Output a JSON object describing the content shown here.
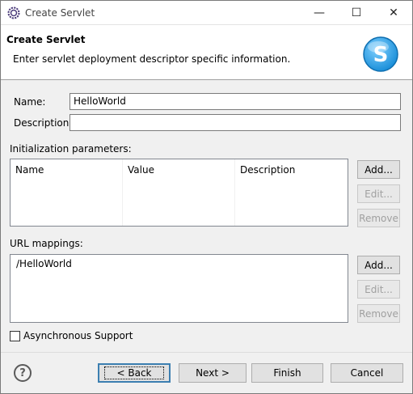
{
  "window": {
    "title": "Create Servlet",
    "minimize_glyph": "—",
    "maximize_glyph": "☐",
    "close_glyph": "✕"
  },
  "header": {
    "title": "Create Servlet",
    "message": "Enter servlet deployment descriptor specific information.",
    "logo_letter": "S"
  },
  "form": {
    "name_label": "Name:",
    "name_value": "HelloWorld",
    "description_label": "Description:",
    "description_value": ""
  },
  "init_params": {
    "label": "Initialization parameters:",
    "columns": [
      "Name",
      "Value",
      "Description"
    ],
    "buttons": {
      "add": "Add...",
      "edit": "Edit...",
      "remove": "Remove"
    }
  },
  "url_mappings": {
    "label": "URL mappings:",
    "items": [
      "/HelloWorld"
    ],
    "buttons": {
      "add": "Add...",
      "edit": "Edit...",
      "remove": "Remove"
    }
  },
  "async": {
    "label": "Asynchronous Support",
    "checked": false
  },
  "footer": {
    "help_glyph": "?",
    "back": "< Back",
    "next": "Next >",
    "finish": "Finish",
    "cancel": "Cancel"
  },
  "colors": {
    "default_button_border": "#3c7fb1",
    "logo_blue": "#1b8fd9"
  },
  "icons": {
    "app": "eclipse-gear-icon",
    "logo": "servlet-s-logo-icon",
    "help": "help-icon"
  }
}
